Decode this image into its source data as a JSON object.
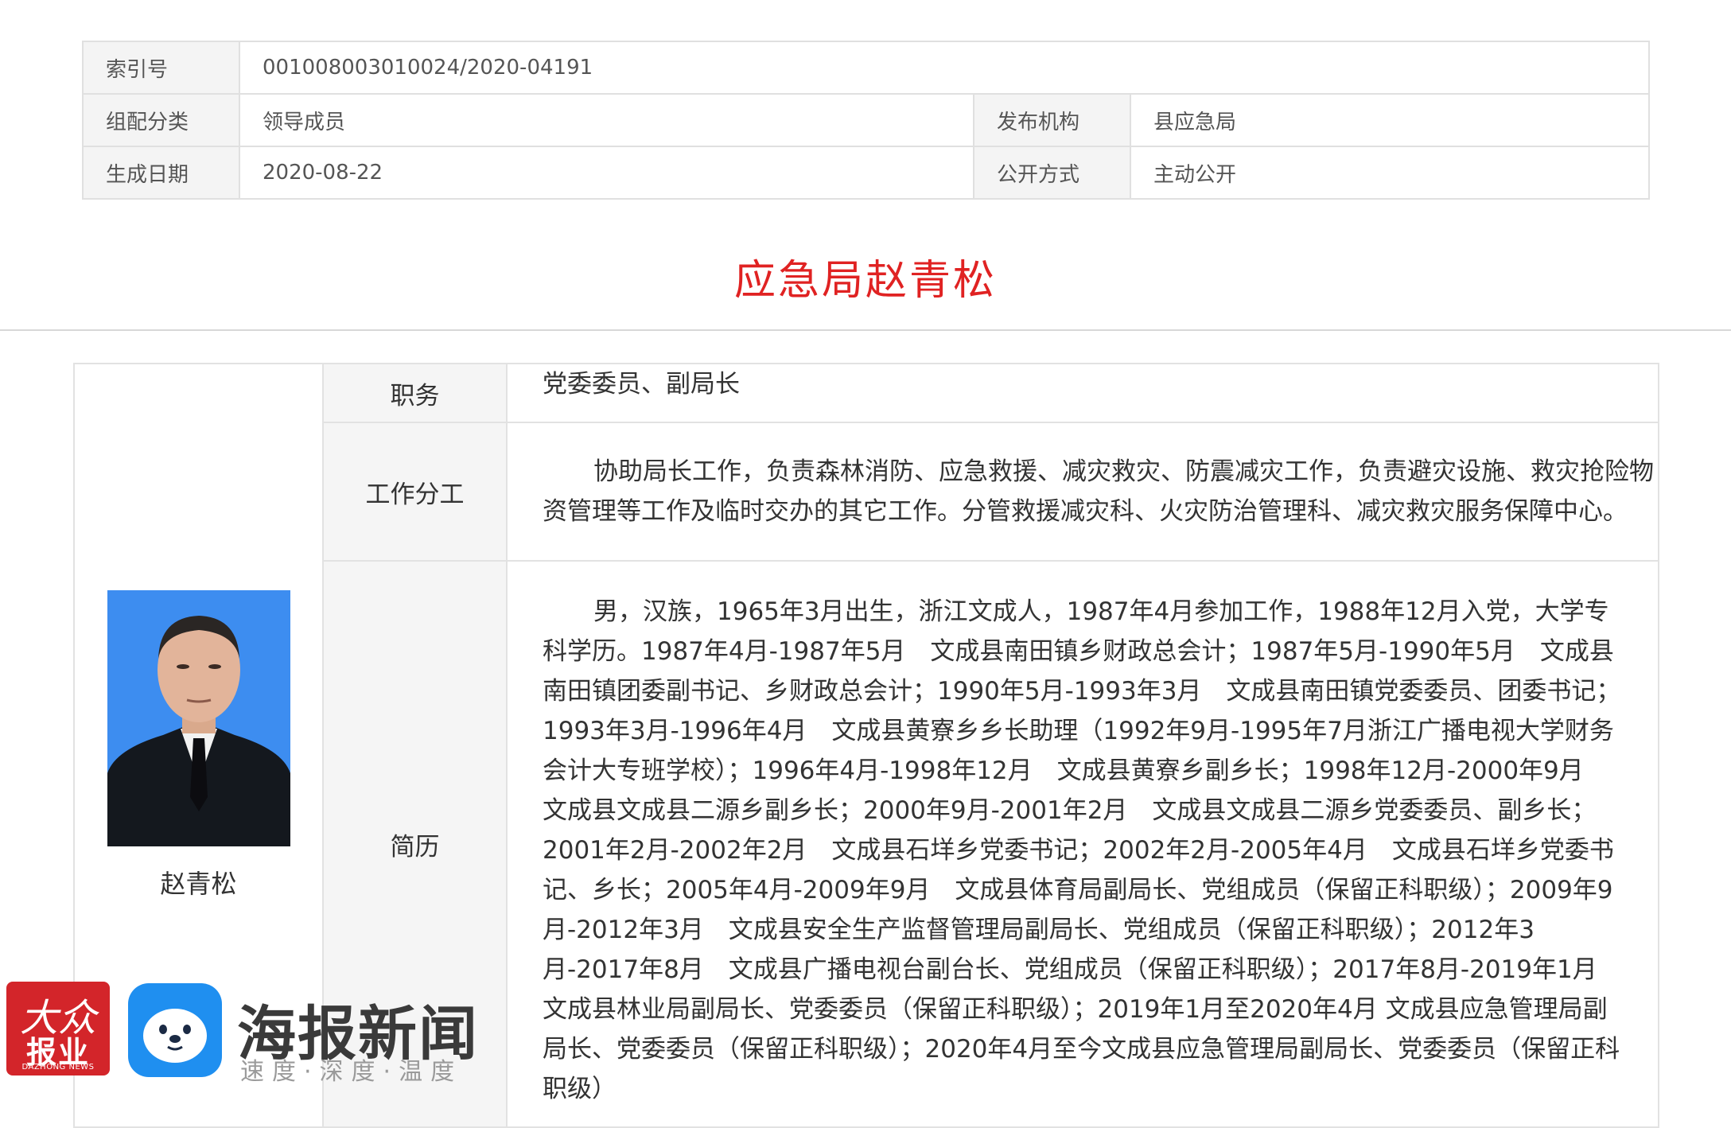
{
  "meta": {
    "index_label": "索引号",
    "index_value": "001008003010024/2020-04191",
    "category_label": "组配分类",
    "category_value": "领导成员",
    "publisher_label": "发布机构",
    "publisher_value": "县应急局",
    "date_label": "生成日期",
    "date_value": "2020-08-22",
    "disclosure_label": "公开方式",
    "disclosure_value": "主动公开"
  },
  "title": "应急局赵青松",
  "profile": {
    "name": "赵青松",
    "position_label": "职务",
    "position_value": "党委委员、副局长",
    "duty_label": "工作分工",
    "duty_value": "协助局长工作，负责森林消防、应急救援、减灾救灾、防震减灾工作，负责避灾设施、救灾抢险物资管理等工作及临时交办的其它工作。分管救援减灾科、火灾防治管理科、减灾救灾服务保障中心。",
    "resume_label": "简历",
    "resume_value": "男，汉族，1965年3月出生，浙江文成人，1987年4月参加工作，1988年12月入党，大学专科学历。1987年4月-1987年5月　文成县南田镇乡财政总会计；1987年5月-1990年5月　文成县南田镇团委副书记、乡财政总会计；1990年5月-1993年3月　文成县南田镇党委委员、团委书记；1993年3月-1996年4月　文成县黄寮乡乡长助理（1992年9月-1995年7月浙江广播电视大学财务会计大专班学校）；1996年4月-1998年12月　文成县黄寮乡副乡长；1998年12月-2000年9月　文成县文成县二源乡副乡长；2000年9月-2001年2月　文成县文成县二源乡党委委员、副乡长；2001年2月-2002年2月　文成县石垟乡党委书记；2002年2月-2005年4月　文成县石垟乡党委书记、乡长；2005年4月-2009年9月　文成县体育局副局长、党组成员（保留正科职级）；2009年9月-2012年3月　文成县安全生产监督管理局副局长、党组成员（保留正科职级）；2012年3月-2017年8月　文成县广播电视台副台长、党组成员（保留正科职级）；2017年8月-2019年1月　文成县林业局副局长、党委委员（保留正科职级）；2019年1月至2020年4月 文成县应急管理局副局长、党委委员（保留正科职级）；2020年4月至今文成县应急管理局副局长、党委委员（保留正科职级）"
  },
  "watermark": {
    "dazhong_big": "大众",
    "dazhong_mid": "报业",
    "dazhong_small": "DAZHONG NEWS",
    "haibao_title": "海报新闻",
    "haibao_slogan": "速度·深度·温度"
  },
  "colors": {
    "title_red": "#e02222",
    "label_bg": "#f5f5f5",
    "border": "#e0e0e0",
    "photo_bg": "#3d8df0",
    "dazhong_red": "#d3252a",
    "haibao_blue": "#1f8ff0"
  }
}
